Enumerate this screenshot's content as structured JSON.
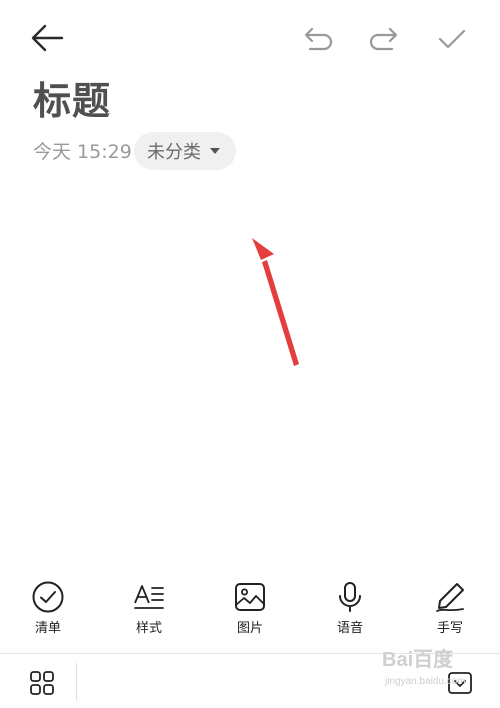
{
  "header": {
    "back_icon": "arrow-left-icon",
    "undo_icon": "undo-icon",
    "redo_icon": "redo-icon",
    "confirm_icon": "check-icon"
  },
  "note": {
    "title": "标题",
    "timestamp": "今天 15:29",
    "category": "未分类",
    "body": ""
  },
  "toolbar": {
    "items": [
      {
        "icon": "checklist-circle-icon",
        "label": "清单"
      },
      {
        "icon": "text-style-icon",
        "label": "样式"
      },
      {
        "icon": "image-icon",
        "label": "图片"
      },
      {
        "icon": "microphone-icon",
        "label": "语音"
      },
      {
        "icon": "pen-icon",
        "label": "手写"
      }
    ]
  },
  "bottom_bar": {
    "apps_icon": "grid-icon",
    "collapse_icon": "keyboard-collapse-icon"
  },
  "watermark": {
    "text": "Bai百度",
    "sub": "jingyan.baidu.com"
  },
  "colors": {
    "annotation_arrow": "#e43d3d",
    "icon": "#888888",
    "toolbar_icon": "#222222"
  }
}
